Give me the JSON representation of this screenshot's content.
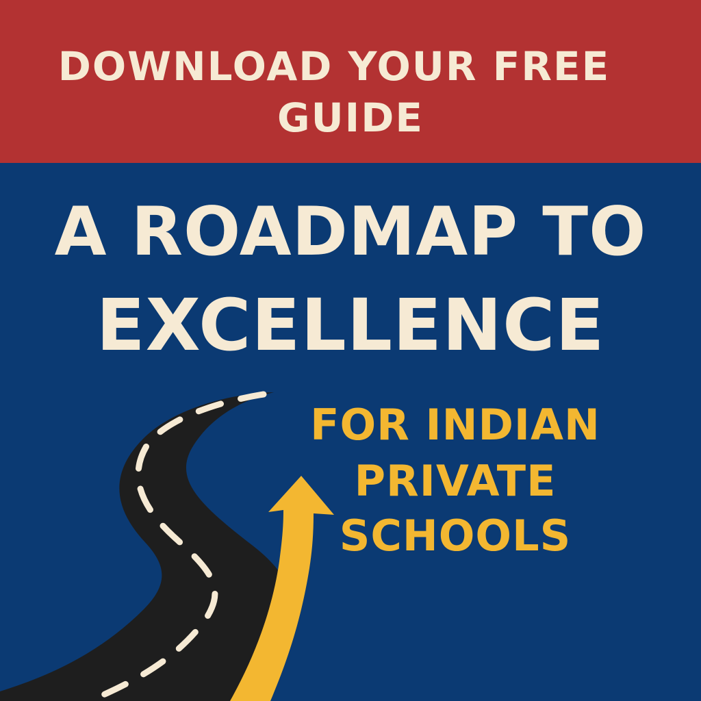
{
  "banner": {
    "line1": "DOWNLOAD YOUR FREE",
    "line2": "GUIDE"
  },
  "headline": {
    "line1": "A ROADMAP TO",
    "line2": "EXCELLENCE"
  },
  "subheading": {
    "line1": "FOR INDIAN",
    "line2": "PRIVATE",
    "line3": "SCHOOLS"
  },
  "colors": {
    "banner_red": "#b33232",
    "background_blue": "#0b3a73",
    "cream_text": "#f6ead4",
    "accent_yellow": "#f3b731",
    "road_black": "#1e1e1e"
  },
  "illustration": {
    "road": "road-illustration",
    "arrow": "up-arrow-icon"
  }
}
